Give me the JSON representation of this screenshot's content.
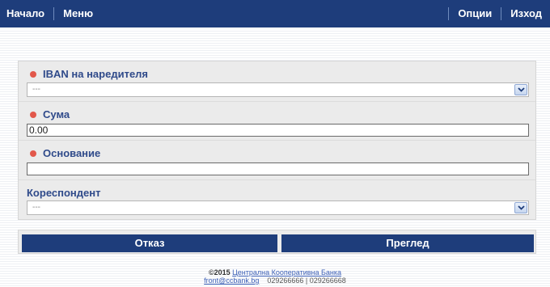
{
  "topbar": {
    "left": [
      "Начало",
      "Меню"
    ],
    "right": [
      "Опции",
      "Изход"
    ]
  },
  "form": {
    "iban": {
      "label": "IBAN на наредителя",
      "value": "---",
      "required": true
    },
    "amount": {
      "label": "Сума",
      "value": "0.00",
      "required": true
    },
    "reason": {
      "label": "Основание",
      "value": "",
      "required": true
    },
    "correspondent": {
      "label": "Кореспондент",
      "value": "---",
      "required": false
    }
  },
  "actions": {
    "cancel": "Отказ",
    "preview": "Преглед"
  },
  "footer": {
    "copyright": "©2015",
    "bank_name": "Централна Кооперативна Банка",
    "email": "front@ccbank.bg",
    "phones": "029266666 | 029266668"
  },
  "colors": {
    "brand": "#1e3d7b",
    "label": "#2f4a8a",
    "required_dot": "#e2584b",
    "link": "#3b5fb6"
  }
}
